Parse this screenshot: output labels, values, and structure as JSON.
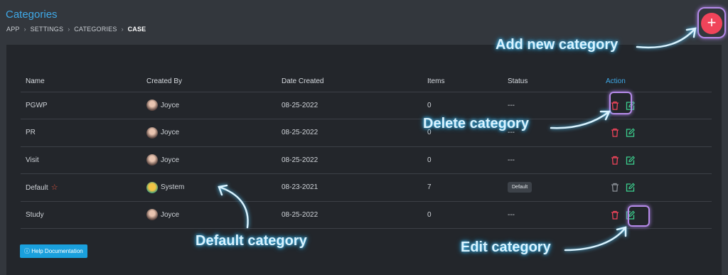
{
  "header": {
    "title": "Categories",
    "breadcrumb": [
      "APP",
      "SETTINGS",
      "CATEGORIES",
      "CASE"
    ]
  },
  "add_button": {
    "label": "+",
    "icon": "plus-icon",
    "color": "#f0445a"
  },
  "table": {
    "columns": [
      "Name",
      "Created By",
      "Date Created",
      "Items",
      "Status",
      "Action"
    ],
    "rows": [
      {
        "name": "PGWP",
        "created_by": "Joyce",
        "date": "08-25-2022",
        "items": "0",
        "status": "---"
      },
      {
        "name": "PR",
        "created_by": "Joyce",
        "date": "08-25-2022",
        "items": "0",
        "status": "---"
      },
      {
        "name": "Visit",
        "created_by": "Joyce",
        "date": "08-25-2022",
        "items": "0",
        "status": "---"
      },
      {
        "name": "Default",
        "created_by": "System",
        "date": "08-23-2021",
        "items": "7",
        "status": "Default"
      },
      {
        "name": "Study",
        "created_by": "Joyce",
        "date": "08-25-2022",
        "items": "0",
        "status": "---"
      }
    ]
  },
  "help_button": {
    "label": "Help Documentation",
    "icon": "info-icon"
  },
  "annotations": {
    "add": "Add new category",
    "delete": "Delete  category",
    "default": "Default category",
    "edit": "Edit category"
  },
  "colors": {
    "accent": "#3fa9e8",
    "delete": "#f0445a",
    "edit": "#3ccf8e",
    "highlight": "#b58ae8"
  }
}
